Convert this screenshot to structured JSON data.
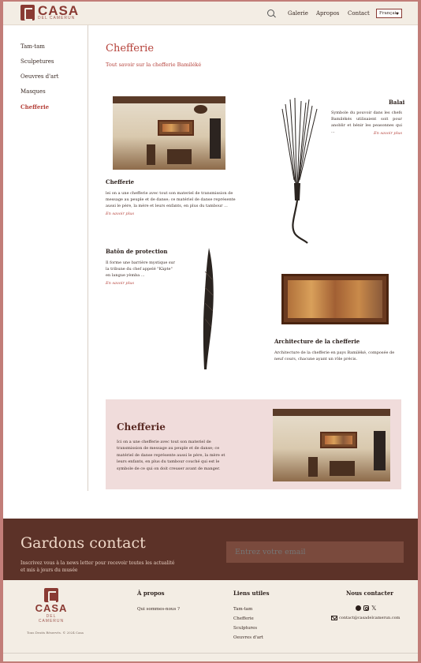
{
  "brand": {
    "name": "CASA",
    "tagline": "DEL CAMERUN"
  },
  "nav": {
    "links": [
      "Galerie",
      "Apropos",
      "Contact"
    ],
    "language": "Français"
  },
  "sidebar": {
    "items": [
      {
        "label": "Tam-tam",
        "active": false
      },
      {
        "label": "Sculpetures",
        "active": false
      },
      {
        "label": "Oeuvres d'art",
        "active": false
      },
      {
        "label": "Masques",
        "active": false
      },
      {
        "label": "Chefferie",
        "active": true
      }
    ]
  },
  "main": {
    "title": "Chefferie",
    "subtitle": "Tout savoir sur la chefferie Bamiléké",
    "cards": [
      {
        "title": "Chefferie",
        "text": "lei on a une chefferie avec tout son materiel de transmission de message au peuple et de danse; ce matériel de danse représente aussi le père, la mère et leurs enfants, en plus du tambour ...",
        "link": "En savoir plus"
      },
      {
        "title": "Balai",
        "text": "Symbole du pouvoir dans les chefs Bamilékés utilisaient soit pour anoblir et bénir les peasonnes qui ...",
        "link": "En savoir plus"
      },
      {
        "title": "Batôn de protection",
        "text": "Il forme une barrière mystique sur la tribune du chef appelé \"Kàpte\" en langue yèmba ...",
        "link": "En savoir plus"
      },
      {
        "title": "Architecture de la chefferie",
        "text": "Architecture de la chefferie en pays Bamiléké, composée de neuf cours, chacune ayant un rôle précis."
      }
    ],
    "feature": {
      "title": "Chefferie",
      "text": "Ici on a une chefferie avec tout son materiel de transmission de message au peuple et de danse; ce matériel de danse représente aussi le père, la mère et leurs enfants, en plus du tambour couché qui est le symbole de ce qui on doit creuser avant de manger."
    }
  },
  "newsletter": {
    "title": "Gardons contact",
    "text": "Inscrivez vous à la news letter pour recevoir toutes les actualité et mis à jours du musée",
    "placeholder": "Entrez votre email"
  },
  "footer": {
    "copyright": "Tous Droits Réservés. © 2024 Casa",
    "about": {
      "title": "À propos",
      "links": [
        "Qui sommes-nous ?"
      ]
    },
    "useful": {
      "title": "Liens utiles",
      "links": [
        "Tam-tam",
        "Chefferie",
        "Sculptures",
        "Oeuvres d'art"
      ]
    },
    "contact": {
      "title": "Nous contacter",
      "email": "contact@casadelcamerun.com"
    }
  },
  "colors": {
    "accent": "#b5413a",
    "brand": "#8a3a33",
    "header_bg": "#f3ede4",
    "newsletter_bg": "#5c3228",
    "feature_bg": "#f0dcdb"
  },
  "icons": [
    "search-icon",
    "facebook-icon",
    "instagram-icon",
    "x-icon",
    "mail-icon"
  ]
}
